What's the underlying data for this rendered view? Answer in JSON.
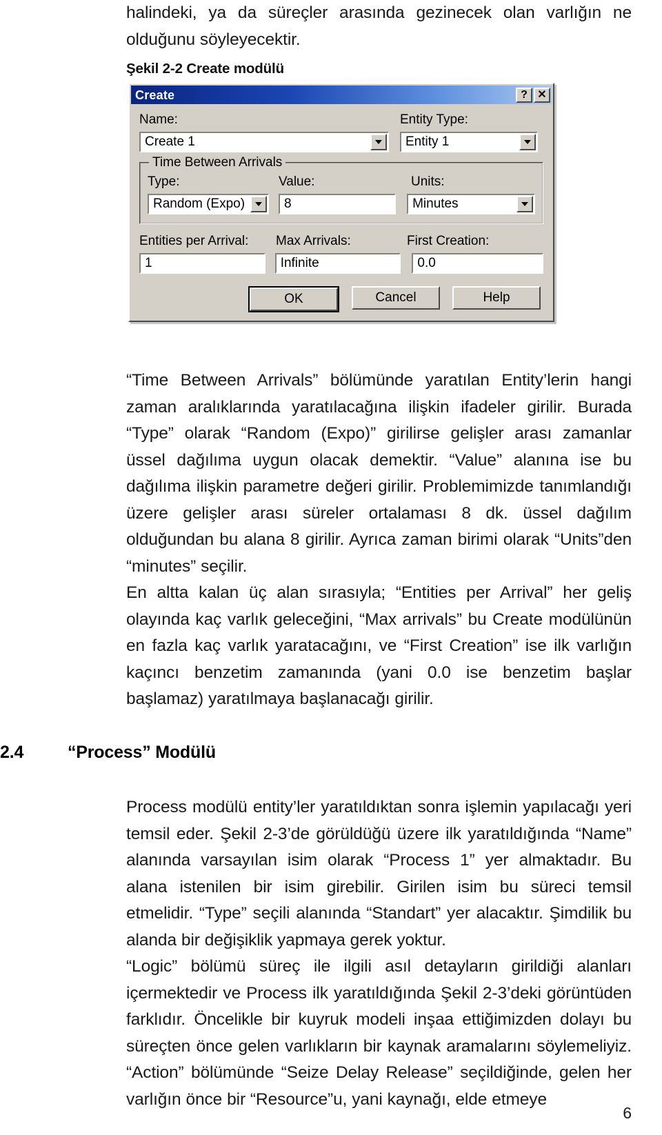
{
  "page": {
    "number": "6",
    "language": "tr"
  },
  "top_paragraph": {
    "text": "halindeki, ya da süreçler arasında gezinecek olan varlığın ne olduğunu söyleyecektir."
  },
  "figure": {
    "caption": "Şekil 2-2 Create modülü",
    "dialog": {
      "titlebar": {
        "title": "Create",
        "help_button": "?",
        "close_button": "✕"
      },
      "fields": {
        "name": {
          "label": "Name:",
          "label_accel": "N",
          "value": "Create 1",
          "control": "combobox"
        },
        "entity_type": {
          "label": "Entity Type:",
          "label_accel": "E",
          "value": "Entity 1",
          "control": "combobox"
        },
        "time_between_arrivals": {
          "group_title": "Time Between Arrivals",
          "type": {
            "label": "Type:",
            "label_accel": "T",
            "value": "Random (Expo)",
            "control": "combobox"
          },
          "value": {
            "label": "Value:",
            "label_accel": "V",
            "value": "8",
            "control": "textbox"
          },
          "units": {
            "label": "Units:",
            "label_accel": "U",
            "value": "Minutes",
            "control": "combobox"
          }
        },
        "entities_per_arrival": {
          "label": "Entities per Arrival:",
          "label_accel": "A",
          "value": "1",
          "control": "textbox"
        },
        "max_arrivals": {
          "label": "Max Arrivals:",
          "label_accel": "M",
          "value": "Infinite",
          "control": "textbox"
        },
        "first_creation": {
          "label": "First Creation:",
          "label_accel": "F",
          "value": "0.0",
          "control": "textbox"
        }
      },
      "buttons": {
        "ok": "OK",
        "cancel": "Cancel",
        "help": "Help"
      }
    }
  },
  "paragraphs": {
    "p1": "“Time Between Arrivals” bölümünde yaratılan Entity’lerin hangi zaman aralıklarında yaratılacağına ilişkin ifadeler girilir. Burada “Type” olarak “Random (Expo)” girilirse gelişler arası zamanlar üssel dağılıma uygun olacak demektir. “Value” alanına ise bu dağılıma ilişkin parametre değeri girilir. Problemimizde tanımlandığı üzere gelişler arası süreler ortalaması 8 dk. üssel dağılım olduğundan bu alana 8 girilir. Ayrıca zaman birimi olarak “Units”den “minutes” seçilir.",
    "p2": "En altta kalan üç alan sırasıyla; “Entities per Arrival” her geliş olayında kaç varlık geleceğini, “Max arrivals” bu Create modülünün en fazla kaç varlık yaratacağını, ve “First Creation” ise ilk varlığın kaçıncı benzetim zamanında (yani 0.0 ise benzetim başlar başlamaz) yaratılmaya başlanacağı girilir.",
    "p3": "Process modülü entity’ler yaratıldıktan sonra işlemin yapılacağı yeri temsil eder. Şekil 2-3’de görüldüğü üzere ilk yaratıldığında “Name” alanında varsayılan isim olarak “Process 1” yer almaktadır. Bu alana istenilen bir isim girebilir. Girilen isim bu süreci temsil etmelidir. “Type” seçili alanında “Standart” yer alacaktır. Şimdilik bu alanda bir değişiklik yapmaya gerek yoktur.",
    "p4": "“Logic” bölümü süreç ile ilgili asıl detayların girildiği alanları içermektedir ve Process ilk yaratıldığında Şekil 2-3’deki görüntüden farklıdır. Öncelikle bir kuyruk modeli inşaa ettiğimizden dolayı bu süreçten önce gelen varlıkların bir kaynak aramalarını söylemeliyiz. “Action” bölümünde “Seize Delay Release” seçildiğinde, gelen her varlığın önce bir “Resource”u, yani kaynağı, elde etmeye"
  },
  "section": {
    "number": "2.4",
    "title": "“Process” Modülü"
  }
}
